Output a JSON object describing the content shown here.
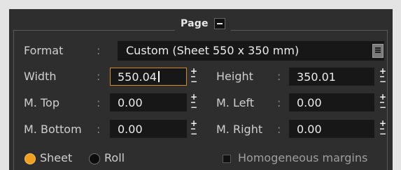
{
  "panel": {
    "title": "Page"
  },
  "format": {
    "label": "Format",
    "value": "Custom (Sheet 550 x 350 mm)"
  },
  "fields": {
    "width": {
      "label": "Width",
      "value": "550.04"
    },
    "height": {
      "label": "Height",
      "value": "350.01"
    },
    "m_top": {
      "label": "M. Top",
      "value": "0.00"
    },
    "m_left": {
      "label": "M. Left",
      "value": "0.00"
    },
    "m_bottom": {
      "label": "M. Bottom",
      "value": "0.00"
    },
    "m_right": {
      "label": "M. Right",
      "value": "0.00"
    }
  },
  "mode": {
    "sheet_label": "Sheet",
    "roll_label": "Roll",
    "selected": "Sheet"
  },
  "homogeneous_margins": {
    "label": "Homogeneous margins",
    "checked": false
  },
  "separator": ":",
  "colors": {
    "panel_bg": "#2e2e2e",
    "field_bg": "#171717",
    "accent": "#f0a020",
    "active_border": "#d48a2e",
    "text": "#cfcfcf"
  }
}
